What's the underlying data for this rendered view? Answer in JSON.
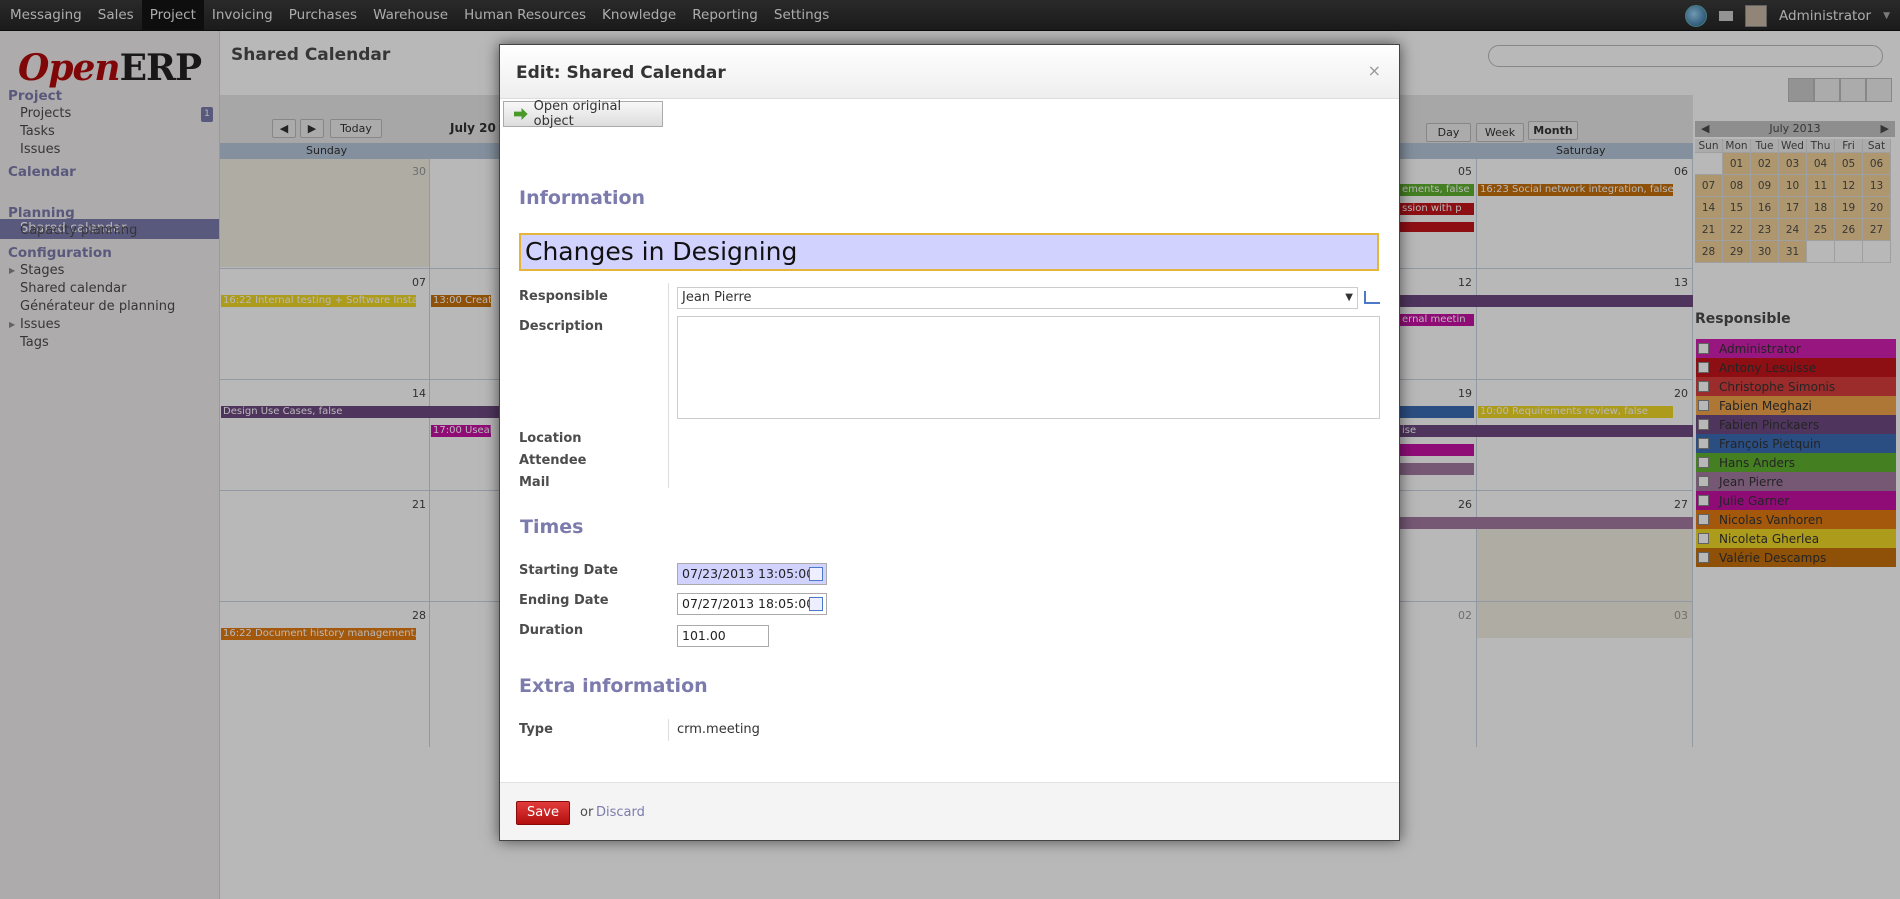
{
  "topbar": {
    "menu": [
      "Messaging",
      "Sales",
      "Project",
      "Invoicing",
      "Purchases",
      "Warehouse",
      "Human Resources",
      "Knowledge",
      "Reporting",
      "Settings"
    ],
    "active": "Project",
    "user": "Administrator"
  },
  "sidebar": {
    "logo_open": "Open",
    "logo_erp": "ERP",
    "project_head": "Project",
    "projects": "Projects",
    "projects_badge": "1",
    "tasks": "Tasks",
    "issues": "Issues",
    "calendar_head": "Calendar",
    "shared_calendar": "Shared calendar",
    "planning_head": "Planning",
    "capacity_planning": "Capacity planning",
    "configuration_head": "Configuration",
    "stages": "Stages",
    "shared_calendar2": "Shared calendar",
    "generateur": "Générateur de planning",
    "issues2": "Issues",
    "tags": "Tags"
  },
  "main": {
    "title": "Shared Calendar",
    "today": "Today",
    "month_label": "July 20",
    "day_btn": "Day",
    "week_btn": "Week",
    "month_btn": "Month",
    "sunday": "Sunday",
    "saturday": "Saturday",
    "minical_title": "July 2013",
    "responsible_head": "Responsible"
  },
  "calendar_days": [
    "30",
    "05",
    "06",
    "07",
    "12",
    "13",
    "14",
    "19",
    "20",
    "21",
    "26",
    "27",
    "28",
    "02",
    "03"
  ],
  "events": [
    "16:22 Internal testing + Software Instal",
    "13:00 Creati",
    "Design Use Cases, false",
    "17:00 Useab",
    "16:22 Document history management, fa",
    "16:23 Social network integration, false",
    "10:00 Requirements review, false",
    "ements, false",
    "ssion with p",
    "ernal meetin",
    "ise"
  ],
  "minical": {
    "headers": [
      "Sun",
      "Mon",
      "Tue",
      "Wed",
      "Thu",
      "Fri",
      "Sat"
    ],
    "days": [
      "",
      "01",
      "02",
      "03",
      "04",
      "05",
      "06",
      "07",
      "08",
      "09",
      "10",
      "11",
      "12",
      "13",
      "14",
      "15",
      "16",
      "17",
      "18",
      "19",
      "20",
      "21",
      "22",
      "23",
      "24",
      "25",
      "26",
      "27",
      "28",
      "29",
      "30",
      "31",
      "",
      "",
      ""
    ]
  },
  "responsibles": [
    {
      "name": "Administrator",
      "color": "#d21fb2"
    },
    {
      "name": "Antony Lesuisse",
      "color": "#c4161c"
    },
    {
      "name": "Christophe Simonis",
      "color": "#d93e3e"
    },
    {
      "name": "Fabien Meghazi",
      "color": "#f3a64b"
    },
    {
      "name": "Fabien Pinckaers",
      "color": "#6e4a82"
    },
    {
      "name": "François Pietquin",
      "color": "#3c6cb5"
    },
    {
      "name": "Hans Anders",
      "color": "#5fb02e"
    },
    {
      "name": "Jean Pierre",
      "color": "#a47aa3"
    },
    {
      "name": "Julie Garner",
      "color": "#c711a6"
    },
    {
      "name": "Nicolas Vanhoren",
      "color": "#e37b10"
    },
    {
      "name": "Nicoleta Gherlea",
      "color": "#f0d826"
    },
    {
      "name": "Valérie Descamps",
      "color": "#c76f0a"
    }
  ],
  "modal": {
    "title": "Edit: Shared Calendar",
    "close": "×",
    "open_original": "Open original object",
    "information": "Information",
    "name_value": "Changes in Designing",
    "responsible_label": "Responsible",
    "responsible_value": "Jean Pierre",
    "description_label": "Description",
    "location_label": "Location",
    "attendee_label": "Attendee",
    "mail_label": "Mail",
    "times": "Times",
    "start_label": "Starting Date",
    "start_value": "07/23/2013 13:05:00",
    "end_label": "Ending Date",
    "end_value": "07/27/2013 18:05:00",
    "duration_label": "Duration",
    "duration_value": "101.00",
    "extra": "Extra information",
    "type_label": "Type",
    "type_value": "crm.meeting",
    "save": "Save",
    "or": "or",
    "discard": "Discard"
  }
}
